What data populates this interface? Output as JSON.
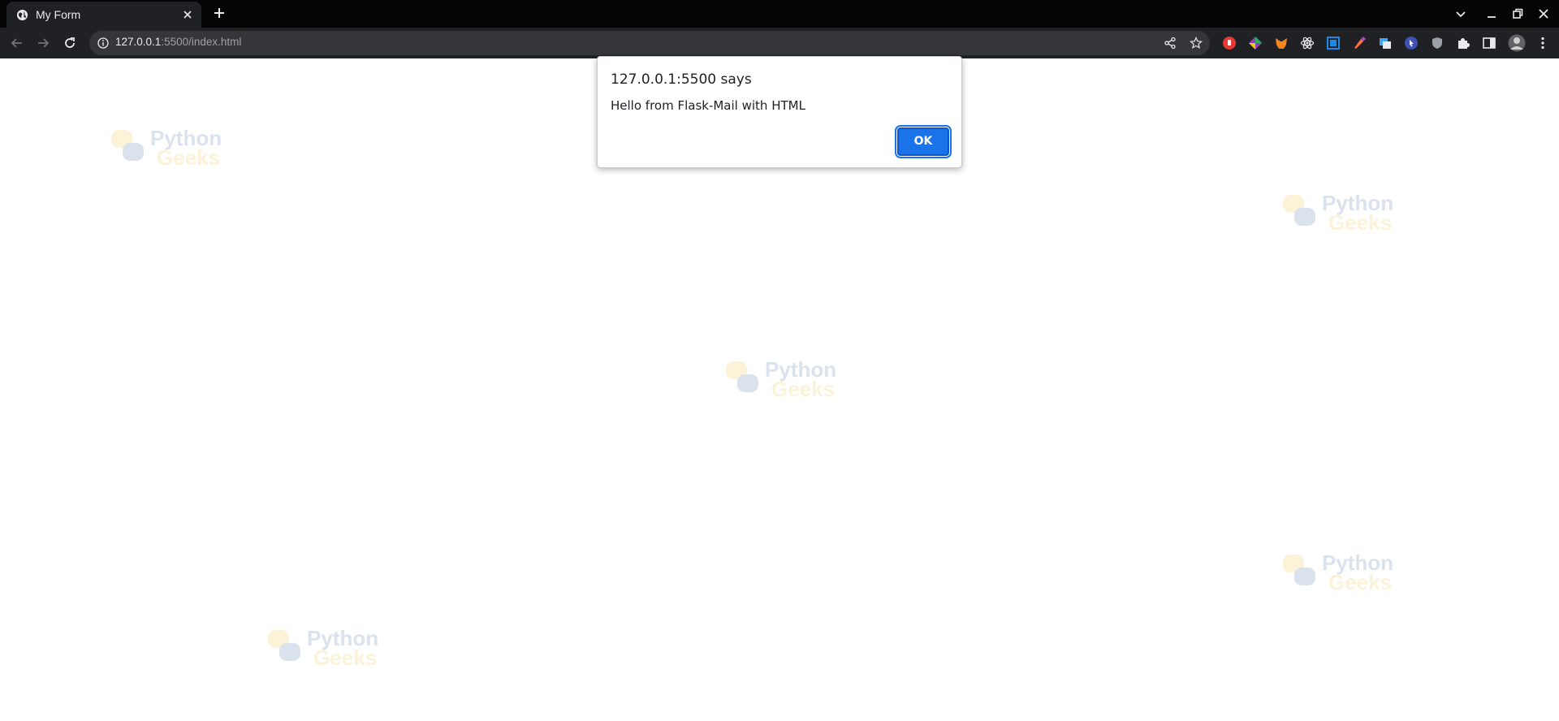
{
  "browser": {
    "tab": {
      "title": "My Form",
      "favicon": "globe-icon",
      "close_icon": "close-icon"
    },
    "new_tab_icon": "plus-icon",
    "window_controls": [
      "tab-search-icon",
      "minimize-icon",
      "restore-icon",
      "close-window-icon"
    ],
    "toolbar": {
      "back_icon": "back-arrow-icon",
      "forward_icon": "forward-arrow-icon",
      "reload_icon": "reload-icon",
      "site_info_icon": "info-icon",
      "url_host": "127.0.0.1",
      "url_rest": ":5500/index.html",
      "share_icon": "share-icon",
      "bookmark_icon": "star-icon",
      "extensions": [
        {
          "name": "extension-red-icon",
          "color": "#e53935"
        },
        {
          "name": "extension-colorwheel-icon",
          "color": "#8e44ad"
        },
        {
          "name": "metamask-fox-icon",
          "color": "#f6851b"
        },
        {
          "name": "react-devtools-icon",
          "color": "#61dafb"
        },
        {
          "name": "screenshot-capture-icon",
          "color": "#1e88e5"
        },
        {
          "name": "color-picker-icon",
          "color": "#ff7043"
        },
        {
          "name": "window-tabs-icon",
          "color": "#42a5f5"
        },
        {
          "name": "cursor-extension-icon",
          "color": "#5c6bc0"
        },
        {
          "name": "shield-icon",
          "color": "#9aa0a6"
        },
        {
          "name": "puzzle-extensions-icon",
          "color": "#e8eaed"
        },
        {
          "name": "side-panel-icon",
          "color": "#e8eaed"
        },
        {
          "name": "profile-avatar-icon",
          "color": "#7a7a7a"
        },
        {
          "name": "kebab-menu-icon",
          "color": "#e8eaed"
        }
      ]
    }
  },
  "page": {
    "watermark": {
      "line1": "Python",
      "line2": "Geeks",
      "logo_colors": [
        "#f2c94c",
        "#5b7fb5"
      ]
    }
  },
  "dialog": {
    "origin": "127.0.0.1:5500 says",
    "message": "Hello from Flask-Mail with HTML",
    "ok_label": "OK"
  }
}
